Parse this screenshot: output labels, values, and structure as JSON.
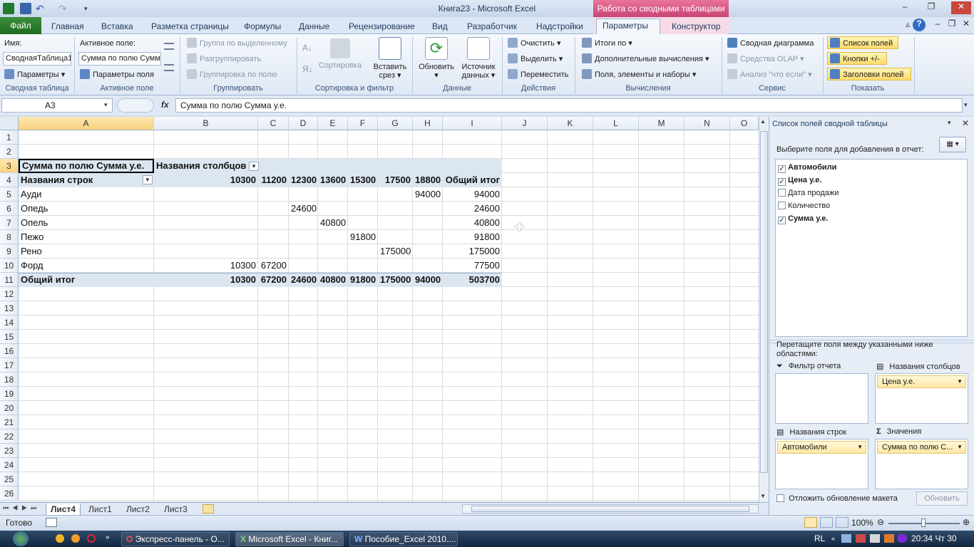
{
  "titlebar": {
    "title": "Книга23 - Microsoft Excel",
    "context_tab": "Работа со сводными таблицами"
  },
  "tabs": {
    "file": "Файл",
    "items": [
      "Главная",
      "Вставка",
      "Разметка страницы",
      "Формулы",
      "Данные",
      "Рецензирование",
      "Вид",
      "Разработчик",
      "Надстройки",
      "Параметры",
      "Конструктор"
    ]
  },
  "ribbon": {
    "pivot": {
      "name_label": "Имя:",
      "name_value": "СводнаяТаблица1",
      "params": "Параметры",
      "group": "Сводная таблица"
    },
    "active_field": {
      "label": "Активное поле:",
      "value": "Сумма по полю Сумма",
      "params": "Параметры поля",
      "group": "Активное поле"
    },
    "grouping": {
      "by_selection": "Группа по выделенному",
      "ungroup": "Разгруппировать",
      "group_field": "Группировка по полю",
      "group": "Группировать"
    },
    "sort": {
      "sort": "Сортировка",
      "slicer_1": "Вставить",
      "slicer_2": "срез",
      "group": "Сортировка и фильтр"
    },
    "data": {
      "refresh": "Обновить",
      "source_1": "Источник",
      "source_2": "данных",
      "group": "Данные"
    },
    "actions": {
      "clear": "Очистить",
      "select": "Выделить",
      "move": "Переместить",
      "group": "Действия"
    },
    "calc": {
      "totals_by": "Итоги по",
      "more_calcs": "Дополнительные вычисления",
      "fields_items": "Поля, элементы и наборы",
      "group": "Вычисления"
    },
    "tools": {
      "pivot_chart": "Сводная диаграмма",
      "olap": "Средства OLAP",
      "whatif": "Анализ \"что если\"",
      "group": "Сервис"
    },
    "show": {
      "field_list": "Список полей",
      "buttons": "Кнопки +/-",
      "headers": "Заголовки полей",
      "group": "Показать"
    }
  },
  "formula_bar": {
    "cell_ref": "A3",
    "fx": "fx",
    "formula": "Сумма по полю Сумма   у.е."
  },
  "grid": {
    "columns": [
      "A",
      "B",
      "C",
      "D",
      "E",
      "F",
      "G",
      "H",
      "I",
      "J",
      "K",
      "L",
      "M",
      "N",
      "O"
    ],
    "rows": [
      "1",
      "2",
      "3",
      "4",
      "5",
      "6",
      "7",
      "8",
      "9",
      "10",
      "11",
      "12",
      "13",
      "14",
      "15",
      "16",
      "17",
      "18",
      "19",
      "20",
      "21",
      "22",
      "23",
      "24",
      "25",
      "26"
    ]
  },
  "pivot": {
    "value_header": "Сумма по полю Сумма   у.е.",
    "col_labels": "Названия столбцов",
    "row_labels": "Названия строк",
    "col_values": [
      "10300",
      "11200",
      "12300",
      "13600",
      "15300",
      "17500",
      "18800"
    ],
    "grand_total_label": "Общий итог",
    "rows": [
      {
        "name": "Ауди",
        "values": [
          "",
          "",
          "",
          "",
          "",
          "",
          "94000"
        ],
        "total": "94000"
      },
      {
        "name": "Опедь",
        "values": [
          "",
          "",
          "24600",
          "",
          "",
          "",
          ""
        ],
        "total": "24600"
      },
      {
        "name": "Опель",
        "values": [
          "",
          "",
          "",
          "40800",
          "",
          "",
          ""
        ],
        "total": "40800"
      },
      {
        "name": "Пежо",
        "values": [
          "",
          "",
          "",
          "",
          "91800",
          "",
          ""
        ],
        "total": "91800"
      },
      {
        "name": "Рено",
        "values": [
          "",
          "",
          "",
          "",
          "",
          "175000",
          ""
        ],
        "total": "175000"
      },
      {
        "name": "Форд",
        "values": [
          "10300",
          "67200",
          "",
          "",
          "",
          "",
          ""
        ],
        "total": "77500"
      }
    ],
    "grand_total_values": [
      "10300",
      "67200",
      "24600",
      "40800",
      "91800",
      "175000",
      "94000"
    ],
    "grand_total": "503700"
  },
  "sheets": [
    "Лист4",
    "Лист1",
    "Лист2",
    "Лист3"
  ],
  "status": {
    "ready": "Готово",
    "zoom": "100%"
  },
  "pane": {
    "title": "Список полей сводной таблицы",
    "choose": "Выберите поля для добавления в отчет:",
    "fields": [
      {
        "label": "Автомобили",
        "checked": true
      },
      {
        "label": "Цена   у.е.",
        "checked": true
      },
      {
        "label": "Дата продажи",
        "checked": false
      },
      {
        "label": "Количество",
        "checked": false
      },
      {
        "label": "Сумма   у.е.",
        "checked": true
      }
    ],
    "drag_hint": "Перетащите поля между указанными ниже областями:",
    "filter_label": "Фильтр отчета",
    "columns_label": "Названия столбцов",
    "rows_label": "Названия строк",
    "values_label": "Значения",
    "col_chip": "Цена   у.е.",
    "row_chip": "Автомобили",
    "val_chip": "Сумма по полю С...",
    "defer": "Отложить обновление макета",
    "update": "Обновить"
  },
  "taskbar": {
    "opera": "Экспресс-панель - О...",
    "excel": "Microsoft Excel - Книг...",
    "word": "Пособие_Excel 2010....",
    "lang": "RL",
    "clock": "20:34 Чт 30"
  }
}
